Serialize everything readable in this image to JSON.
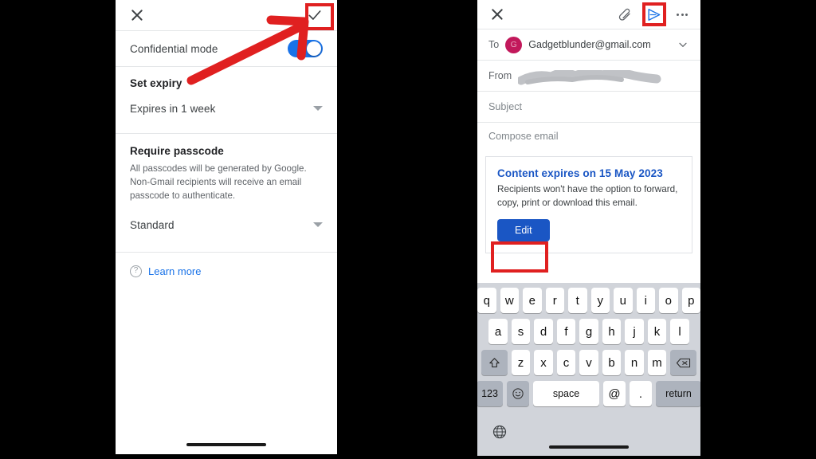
{
  "left_panel": {
    "appbar": {
      "close_icon": "close-icon",
      "confirm_icon": "checkmark-icon"
    },
    "rows": {
      "confidential_mode_label": "Confidential mode",
      "confidential_mode_enabled": true,
      "set_expiry_heading": "Set expiry",
      "expiry_value": "Expires in 1 week",
      "require_passcode_heading": "Require passcode",
      "require_passcode_desc": "All passcodes will be generated by Google. Non-Gmail recipients will receive an email passcode to authenticate.",
      "passcode_value": "Standard",
      "learn_more_label": "Learn more",
      "learn_more_icon": "help-circle-icon"
    }
  },
  "right_panel": {
    "appbar": {
      "close_icon": "close-icon",
      "attach_icon": "paperclip-icon",
      "send_icon": "send-icon",
      "more_icon": "overflow-menu-icon"
    },
    "fields": {
      "to_label": "To",
      "to_avatar_initial": "G",
      "to_value": "Gadgetblunder@gmail.com",
      "expand_icon": "chevron-down-icon",
      "from_label": "From",
      "from_value_redacted": "",
      "subject_placeholder": "Subject",
      "body_placeholder": "Compose email"
    },
    "info_card": {
      "title": "Content expires on 15 May 2023",
      "description": "Recipients won't have the option to forward, copy, print or download this email.",
      "edit_button_label": "Edit"
    },
    "keyboard": {
      "row1": [
        "q",
        "w",
        "e",
        "r",
        "t",
        "y",
        "u",
        "i",
        "o",
        "p"
      ],
      "row2": [
        "a",
        "s",
        "d",
        "f",
        "g",
        "h",
        "j",
        "k",
        "l"
      ],
      "row3": [
        "z",
        "x",
        "c",
        "v",
        "b",
        "n",
        "m"
      ],
      "shift_icon": "shift-icon",
      "backspace_icon": "backspace-icon",
      "numbers_key": "123",
      "emoji_icon": "emoji-icon",
      "space_key": "space",
      "at_key": "@",
      "period_key": ".",
      "return_key": "return",
      "globe_icon": "globe-icon"
    }
  },
  "annotations": {
    "checkmark_highlight": "red-box-around-confirm-checkmark",
    "send_highlight": "red-box-around-send-button",
    "edit_highlight": "red-box-around-edit-button",
    "arrow": "red-arrow-pointing-to-confirm-checkmark",
    "accent_color": "#e02020"
  }
}
